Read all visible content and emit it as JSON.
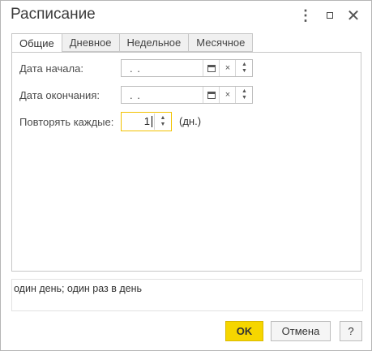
{
  "window": {
    "title": "Расписание",
    "more_glyph": "⋮",
    "close_glyph": "✕"
  },
  "tabs": [
    {
      "label": "Общие",
      "active": true
    },
    {
      "label": "Дневное",
      "active": false
    },
    {
      "label": "Недельное",
      "active": false
    },
    {
      "label": "Месячное",
      "active": false
    }
  ],
  "form": {
    "start_date": {
      "label": "Дата начала:",
      "value": ". ."
    },
    "end_date": {
      "label": "Дата окончания:",
      "value": ". ."
    },
    "repeat": {
      "label": "Повторять каждые:",
      "value": "1",
      "unit": "(дн.)"
    },
    "clear_glyph": "×",
    "spin_up": "▲",
    "spin_down": "▼"
  },
  "summary_text": "один день; один раз в день",
  "buttons": {
    "ok": "OK",
    "cancel": "Отмена",
    "help": "?"
  },
  "colors": {
    "accent": "#f6d600",
    "focus_border": "#f2c200"
  }
}
